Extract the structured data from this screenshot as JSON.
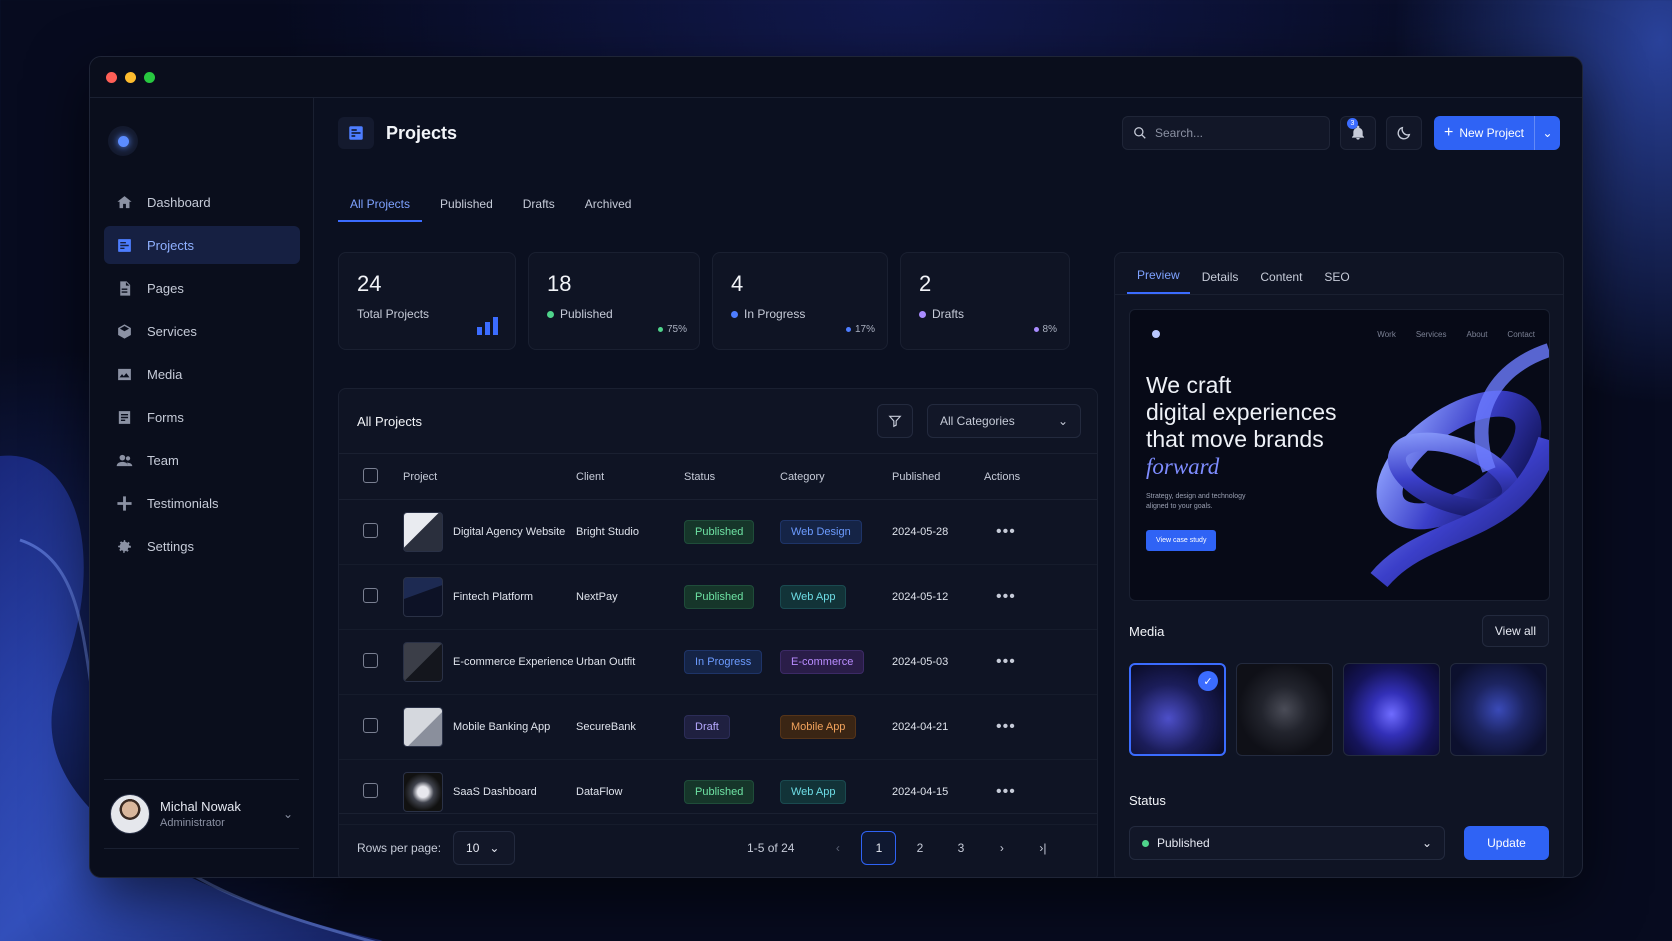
{
  "colors": {
    "accent": "#2f63f5",
    "published": "#6ee3a4",
    "progress": "#6c9bff",
    "draft": "#b7a9ff"
  },
  "window": {
    "controls": [
      "close",
      "minimize",
      "maximize"
    ]
  },
  "sidebar": {
    "items": [
      {
        "label": "Dashboard",
        "icon": "home-icon"
      },
      {
        "label": "Projects",
        "icon": "projects-icon",
        "active": true
      },
      {
        "label": "Pages",
        "icon": "page-icon"
      },
      {
        "label": "Services",
        "icon": "box-icon"
      },
      {
        "label": "Media",
        "icon": "image-icon"
      },
      {
        "label": "Forms",
        "icon": "form-icon"
      },
      {
        "label": "Team",
        "icon": "team-icon"
      },
      {
        "label": "Testimonials",
        "icon": "testimonials-icon"
      },
      {
        "label": "Settings",
        "icon": "gear-icon"
      }
    ],
    "user": {
      "name": "Michal Nowak",
      "role": "Administrator"
    }
  },
  "header": {
    "title": "Projects",
    "search_placeholder": "Search...",
    "notifications_count": "3",
    "new_project_label": "New Project"
  },
  "tabs": [
    "All Projects",
    "Published",
    "Drafts",
    "Archived"
  ],
  "stats": [
    {
      "value": "24",
      "label": "Total Projects"
    },
    {
      "value": "18",
      "label": "Published",
      "pct": "75%"
    },
    {
      "value": "4",
      "label": "In Progress",
      "pct": "17%"
    },
    {
      "value": "2",
      "label": "Drafts",
      "pct": "8%"
    }
  ],
  "table": {
    "title": "All Projects",
    "category_filter": "All Categories",
    "columns": [
      "Project",
      "Client",
      "Status",
      "Category",
      "Published",
      "Actions"
    ],
    "rows": [
      {
        "project": "Digital Agency Website",
        "client": "Bright Studio",
        "status": "Published",
        "category": "Web Design",
        "published": "2024-05-28"
      },
      {
        "project": "Fintech Platform",
        "client": "NextPay",
        "status": "Published",
        "category": "Web App",
        "published": "2024-05-12"
      },
      {
        "project": "E-commerce Experience",
        "client": "Urban Outfit",
        "status": "In Progress",
        "category": "E-commerce",
        "published": "2024-05-03"
      },
      {
        "project": "Mobile Banking App",
        "client": "SecureBank",
        "status": "Draft",
        "category": "Mobile App",
        "published": "2024-04-21"
      },
      {
        "project": "SaaS Dashboard",
        "client": "DataFlow",
        "status": "Published",
        "category": "Web App",
        "published": "2024-04-15"
      }
    ],
    "rows_per_page_label": "Rows per page:",
    "rows_per_page": "10",
    "range": "1-5 of 24",
    "pages": [
      "1",
      "2",
      "3"
    ]
  },
  "preview": {
    "tabs": [
      "Preview",
      "Details",
      "Content",
      "SEO"
    ],
    "hero_nav": [
      "Work",
      "Services",
      "About",
      "Contact"
    ],
    "hero_title_1": "We craft",
    "hero_title_2": "digital experiences",
    "hero_title_3": "that move brands",
    "hero_title_accent": "forward",
    "hero_sub": "Strategy, design and technology aligned to your goals.",
    "hero_cta": "View case study",
    "media_title": "Media",
    "view_all": "View all",
    "status_title": "Status",
    "status_value": "Published",
    "update_label": "Update"
  }
}
